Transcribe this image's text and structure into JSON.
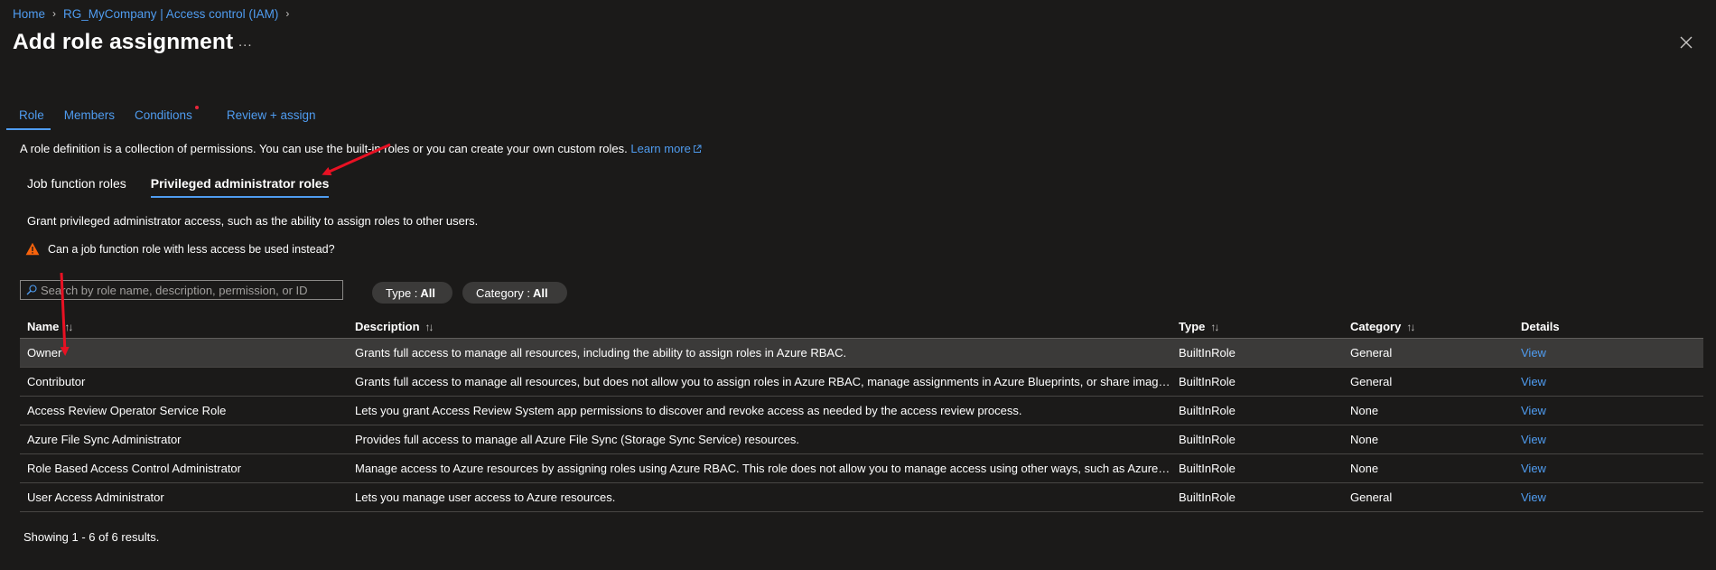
{
  "breadcrumb": {
    "items": [
      "Home",
      "RG_MyCompany | Access control (IAM)"
    ]
  },
  "header": {
    "title": "Add role assignment",
    "more": "...",
    "close_icon": "close-icon"
  },
  "tabs": [
    {
      "label": "Role",
      "active": true
    },
    {
      "label": "Members",
      "active": false
    },
    {
      "label": "Conditions",
      "active": false,
      "required_dot": true
    },
    {
      "label": "Review + assign",
      "active": false
    }
  ],
  "intro": {
    "text": "A role definition is a collection of permissions. You can use the built-in roles or you can create your own custom roles.",
    "learn_more": "Learn more"
  },
  "subtabs": [
    {
      "label": "Job function roles",
      "active": false
    },
    {
      "label": "Privileged administrator roles",
      "active": true
    }
  ],
  "grant_text": "Grant privileged administrator access, such as the ability to assign roles to other users.",
  "warning": {
    "text": "Can a job function role with less access be used instead?",
    "icon": "warning-icon",
    "color": "#f7630c"
  },
  "search": {
    "placeholder": "Search by role name, description, permission, or ID",
    "value": ""
  },
  "filters": [
    {
      "label": "Type :",
      "value": "All"
    },
    {
      "label": "Category :",
      "value": "All"
    }
  ],
  "table": {
    "columns": [
      "Name",
      "Description",
      "Type",
      "Category",
      "Details"
    ],
    "rows": [
      {
        "name": "Owner",
        "description": "Grants full access to manage all resources, including the ability to assign roles in Azure RBAC.",
        "type": "BuiltInRole",
        "category": "General",
        "details": "View"
      },
      {
        "name": "Contributor",
        "description": "Grants full access to manage all resources, but does not allow you to assign roles in Azure RBAC, manage assignments in Azure Blueprints, or share image galleries.",
        "type": "BuiltInRole",
        "category": "General",
        "details": "View"
      },
      {
        "name": "Access Review Operator Service Role",
        "description": "Lets you grant Access Review System app permissions to discover and revoke access as needed by the access review process.",
        "type": "BuiltInRole",
        "category": "None",
        "details": "View"
      },
      {
        "name": "Azure File Sync Administrator",
        "description": "Provides full access to manage all Azure File Sync (Storage Sync Service) resources.",
        "type": "BuiltInRole",
        "category": "None",
        "details": "View"
      },
      {
        "name": "Role Based Access Control Administrator",
        "description": "Manage access to Azure resources by assigning roles using Azure RBAC. This role does not allow you to manage access using other ways, such as Azure Policy.",
        "type": "BuiltInRole",
        "category": "None",
        "details": "View"
      },
      {
        "name": "User Access Administrator",
        "description": "Lets you manage user access to Azure resources.",
        "type": "BuiltInRole",
        "category": "General",
        "details": "View"
      }
    ]
  },
  "footer": "Showing 1 - 6 of 6 results.",
  "colors": {
    "background": "#1b1a19",
    "accent": "#4f9cf0",
    "selected_row": "#3b3a39",
    "annotation_arrow": "#e81123"
  }
}
